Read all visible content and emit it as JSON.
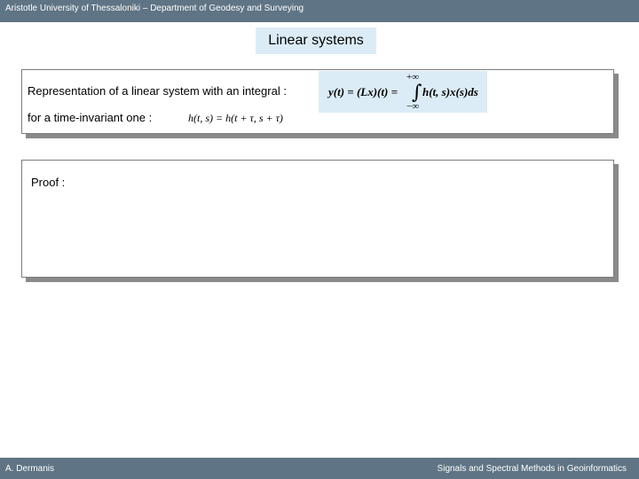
{
  "header": {
    "text": "Aristotle University of Thessaloniki – Department of Geodesy and Surveying"
  },
  "slide": {
    "title": "Linear systems",
    "box1": {
      "line1": "Representation of a linear system with an integral :",
      "line2": "for a time-invariant one :",
      "formula_main": "y(t) = (Lx)(t) = ",
      "integral_upper": "+∞",
      "integral_lower": "−∞",
      "integrand": "h(t, s)x(s)ds",
      "formula_invariant": "h(t, s) = h(t + τ, s + τ)"
    },
    "box2": {
      "label": "Proof :"
    }
  },
  "footer": {
    "author": "A. Dermanis",
    "course": "Signals and Spectral Methods in Geoinformatics"
  },
  "colors": {
    "bar": "#5f7484",
    "title_bg": "#dcecf7",
    "formula_bg": "#dcecf7",
    "shadow": "#8a8a8a"
  }
}
